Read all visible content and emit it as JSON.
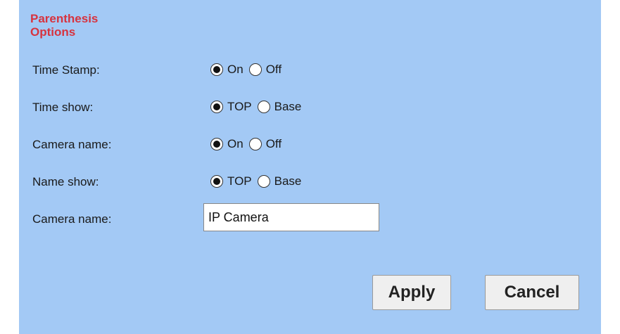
{
  "section_title": "Parenthesis Options",
  "rows": [
    {
      "label": "Time Stamp:",
      "options": [
        "On",
        "Off"
      ],
      "selected": "On"
    },
    {
      "label": "Time show:",
      "options": [
        "TOP",
        "Base"
      ],
      "selected": "TOP"
    },
    {
      "label": "Camera name:",
      "options": [
        "On",
        "Off"
      ],
      "selected": "On"
    },
    {
      "label": "Name show:",
      "options": [
        "TOP",
        "Base"
      ],
      "selected": "TOP"
    }
  ],
  "camera_name_field": {
    "label": "Camera name:",
    "value": "IP Camera"
  },
  "buttons": {
    "apply": "Apply",
    "cancel": "Cancel"
  },
  "colors": {
    "panel_bg": "#a3c9f5",
    "title": "#d7333f"
  }
}
